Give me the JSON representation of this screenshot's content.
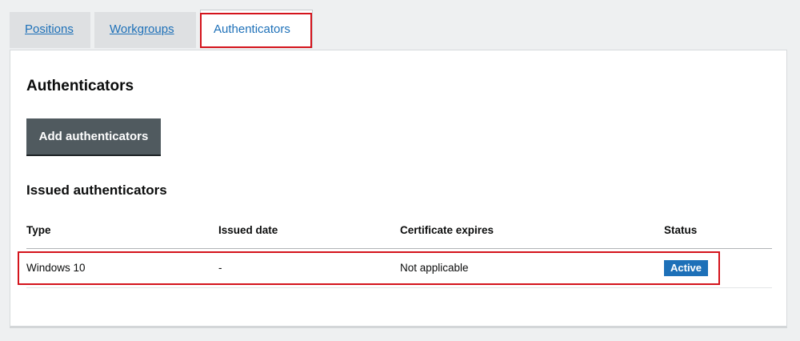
{
  "tabs": [
    {
      "label": "Positions",
      "active": false
    },
    {
      "label": "Workgroups",
      "active": false
    },
    {
      "label": "Authenticators",
      "active": true
    }
  ],
  "panel": {
    "title": "Authenticators",
    "add_button_label": "Add authenticators",
    "section_title": "Issued authenticators"
  },
  "table": {
    "columns": [
      "Type",
      "Issued date",
      "Certificate expires",
      "Status"
    ],
    "rows": [
      {
        "type": "Windows 10",
        "issued_date": "-",
        "certificate_expires": "Not applicable",
        "status": "Active"
      }
    ]
  },
  "colors": {
    "link": "#1d70b8",
    "button_bg": "#505a5f",
    "status_badge_bg": "#1d70b8",
    "highlight": "#d4141c"
  }
}
